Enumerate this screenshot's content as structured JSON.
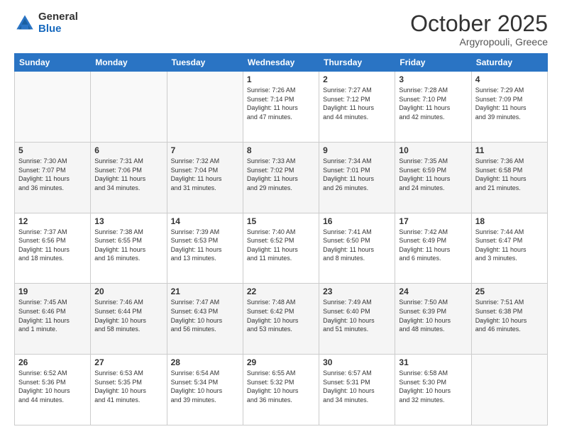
{
  "logo": {
    "general": "General",
    "blue": "Blue"
  },
  "title": "October 2025",
  "subtitle": "Argyropouli, Greece",
  "days_header": [
    "Sunday",
    "Monday",
    "Tuesday",
    "Wednesday",
    "Thursday",
    "Friday",
    "Saturday"
  ],
  "weeks": [
    [
      {
        "num": "",
        "info": ""
      },
      {
        "num": "",
        "info": ""
      },
      {
        "num": "",
        "info": ""
      },
      {
        "num": "1",
        "info": "Sunrise: 7:26 AM\nSunset: 7:14 PM\nDaylight: 11 hours\nand 47 minutes."
      },
      {
        "num": "2",
        "info": "Sunrise: 7:27 AM\nSunset: 7:12 PM\nDaylight: 11 hours\nand 44 minutes."
      },
      {
        "num": "3",
        "info": "Sunrise: 7:28 AM\nSunset: 7:10 PM\nDaylight: 11 hours\nand 42 minutes."
      },
      {
        "num": "4",
        "info": "Sunrise: 7:29 AM\nSunset: 7:09 PM\nDaylight: 11 hours\nand 39 minutes."
      }
    ],
    [
      {
        "num": "5",
        "info": "Sunrise: 7:30 AM\nSunset: 7:07 PM\nDaylight: 11 hours\nand 36 minutes."
      },
      {
        "num": "6",
        "info": "Sunrise: 7:31 AM\nSunset: 7:06 PM\nDaylight: 11 hours\nand 34 minutes."
      },
      {
        "num": "7",
        "info": "Sunrise: 7:32 AM\nSunset: 7:04 PM\nDaylight: 11 hours\nand 31 minutes."
      },
      {
        "num": "8",
        "info": "Sunrise: 7:33 AM\nSunset: 7:02 PM\nDaylight: 11 hours\nand 29 minutes."
      },
      {
        "num": "9",
        "info": "Sunrise: 7:34 AM\nSunset: 7:01 PM\nDaylight: 11 hours\nand 26 minutes."
      },
      {
        "num": "10",
        "info": "Sunrise: 7:35 AM\nSunset: 6:59 PM\nDaylight: 11 hours\nand 24 minutes."
      },
      {
        "num": "11",
        "info": "Sunrise: 7:36 AM\nSunset: 6:58 PM\nDaylight: 11 hours\nand 21 minutes."
      }
    ],
    [
      {
        "num": "12",
        "info": "Sunrise: 7:37 AM\nSunset: 6:56 PM\nDaylight: 11 hours\nand 18 minutes."
      },
      {
        "num": "13",
        "info": "Sunrise: 7:38 AM\nSunset: 6:55 PM\nDaylight: 11 hours\nand 16 minutes."
      },
      {
        "num": "14",
        "info": "Sunrise: 7:39 AM\nSunset: 6:53 PM\nDaylight: 11 hours\nand 13 minutes."
      },
      {
        "num": "15",
        "info": "Sunrise: 7:40 AM\nSunset: 6:52 PM\nDaylight: 11 hours\nand 11 minutes."
      },
      {
        "num": "16",
        "info": "Sunrise: 7:41 AM\nSunset: 6:50 PM\nDaylight: 11 hours\nand 8 minutes."
      },
      {
        "num": "17",
        "info": "Sunrise: 7:42 AM\nSunset: 6:49 PM\nDaylight: 11 hours\nand 6 minutes."
      },
      {
        "num": "18",
        "info": "Sunrise: 7:44 AM\nSunset: 6:47 PM\nDaylight: 11 hours\nand 3 minutes."
      }
    ],
    [
      {
        "num": "19",
        "info": "Sunrise: 7:45 AM\nSunset: 6:46 PM\nDaylight: 11 hours\nand 1 minute."
      },
      {
        "num": "20",
        "info": "Sunrise: 7:46 AM\nSunset: 6:44 PM\nDaylight: 10 hours\nand 58 minutes."
      },
      {
        "num": "21",
        "info": "Sunrise: 7:47 AM\nSunset: 6:43 PM\nDaylight: 10 hours\nand 56 minutes."
      },
      {
        "num": "22",
        "info": "Sunrise: 7:48 AM\nSunset: 6:42 PM\nDaylight: 10 hours\nand 53 minutes."
      },
      {
        "num": "23",
        "info": "Sunrise: 7:49 AM\nSunset: 6:40 PM\nDaylight: 10 hours\nand 51 minutes."
      },
      {
        "num": "24",
        "info": "Sunrise: 7:50 AM\nSunset: 6:39 PM\nDaylight: 10 hours\nand 48 minutes."
      },
      {
        "num": "25",
        "info": "Sunrise: 7:51 AM\nSunset: 6:38 PM\nDaylight: 10 hours\nand 46 minutes."
      }
    ],
    [
      {
        "num": "26",
        "info": "Sunrise: 6:52 AM\nSunset: 5:36 PM\nDaylight: 10 hours\nand 44 minutes."
      },
      {
        "num": "27",
        "info": "Sunrise: 6:53 AM\nSunset: 5:35 PM\nDaylight: 10 hours\nand 41 minutes."
      },
      {
        "num": "28",
        "info": "Sunrise: 6:54 AM\nSunset: 5:34 PM\nDaylight: 10 hours\nand 39 minutes."
      },
      {
        "num": "29",
        "info": "Sunrise: 6:55 AM\nSunset: 5:32 PM\nDaylight: 10 hours\nand 36 minutes."
      },
      {
        "num": "30",
        "info": "Sunrise: 6:57 AM\nSunset: 5:31 PM\nDaylight: 10 hours\nand 34 minutes."
      },
      {
        "num": "31",
        "info": "Sunrise: 6:58 AM\nSunset: 5:30 PM\nDaylight: 10 hours\nand 32 minutes."
      },
      {
        "num": "",
        "info": ""
      }
    ]
  ]
}
